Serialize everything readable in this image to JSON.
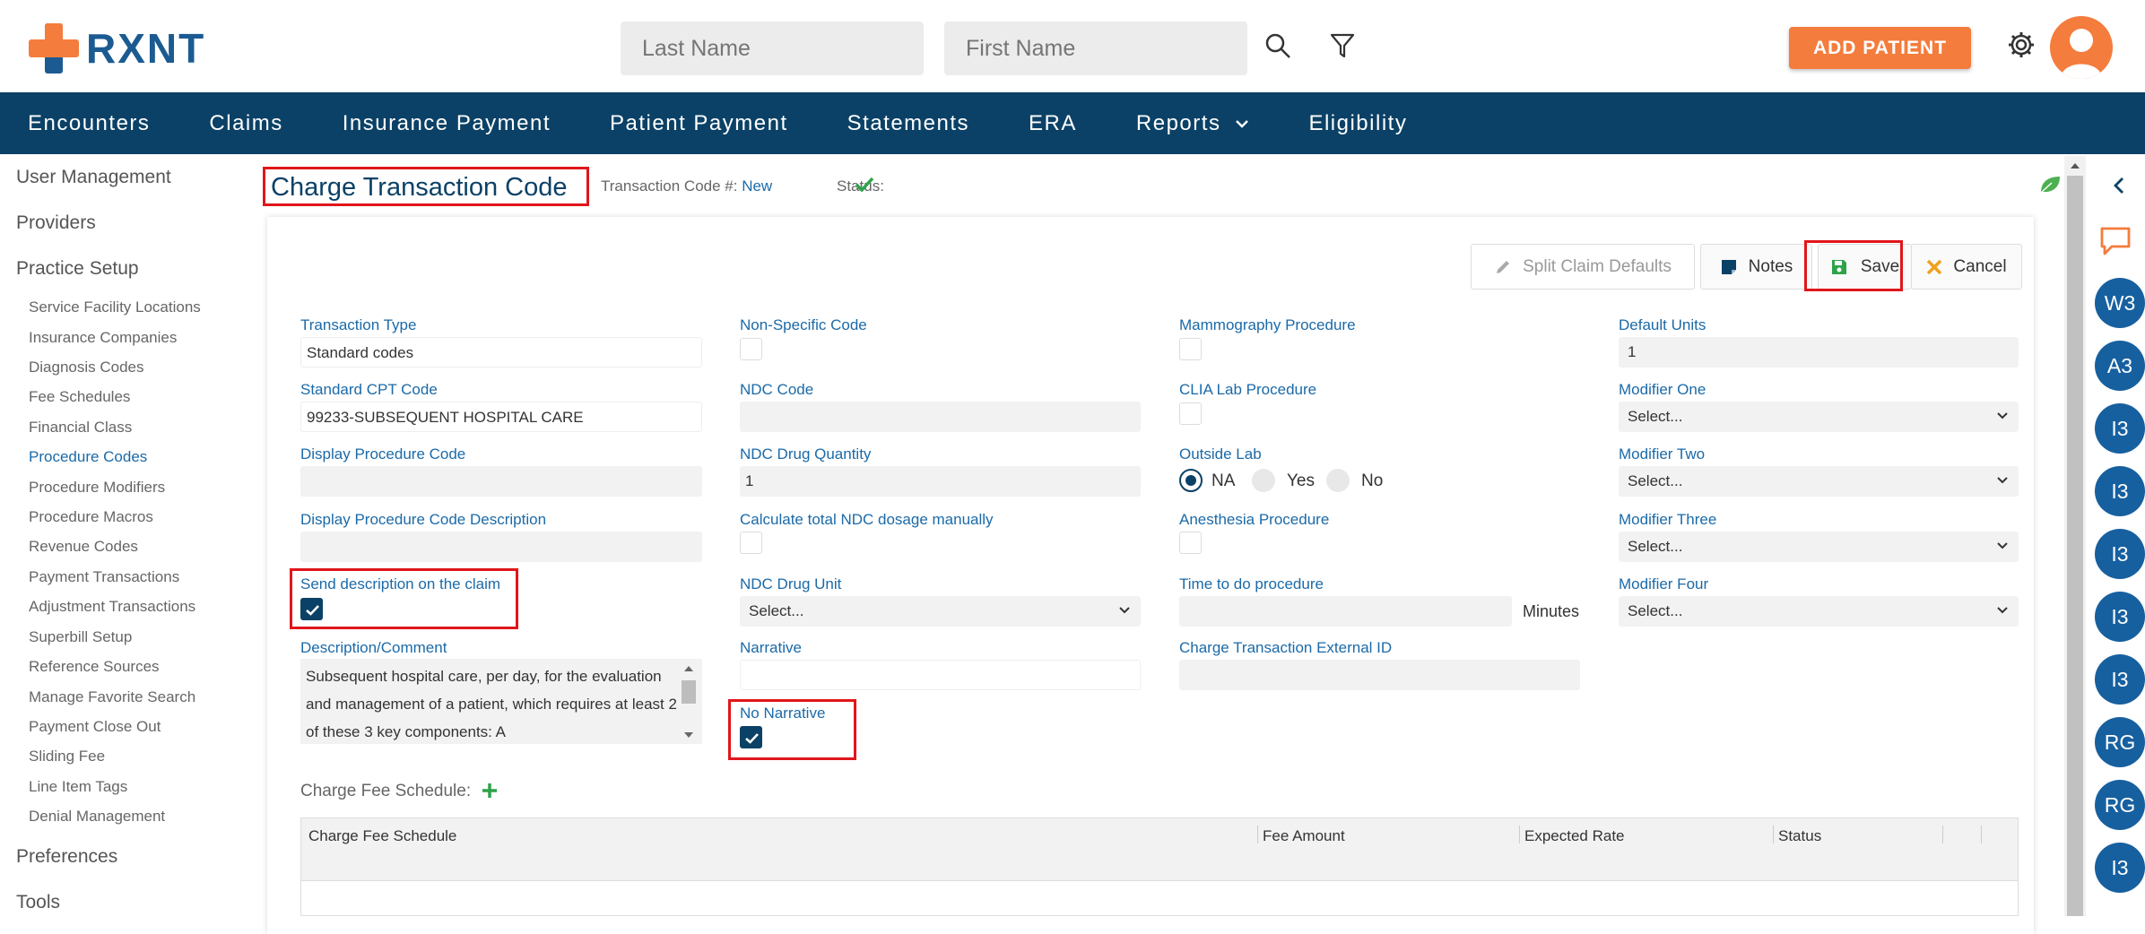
{
  "app": {
    "brand": "RXNT"
  },
  "header": {
    "last_name_placeholder": "Last Name",
    "first_name_placeholder": "First Name",
    "add_patient_label": "ADD PATIENT"
  },
  "nav": {
    "items": [
      "Encounters",
      "Claims",
      "Insurance Payment",
      "Patient Payment",
      "Statements",
      "ERA",
      "Reports",
      "Eligibility"
    ]
  },
  "sidebar": {
    "sections": [
      "User Management",
      "Providers",
      "Practice Setup",
      "Preferences",
      "Tools"
    ],
    "items": [
      "Service Facility Locations",
      "Insurance Companies",
      "Diagnosis Codes",
      "Fee Schedules",
      "Financial Class",
      "Procedure Codes",
      "Procedure Modifiers",
      "Procedure Macros",
      "Revenue Codes",
      "Payment Transactions",
      "Adjustment Transactions",
      "Superbill Setup",
      "Reference Sources",
      "Manage Favorite Search",
      "Payment Close Out",
      "Sliding Fee",
      "Line Item Tags",
      "Denial Management"
    ],
    "active": "Procedure Codes"
  },
  "page": {
    "title": "Charge Transaction Code",
    "code_label": "Transaction Code #:",
    "code_value": "New",
    "status_label": "Status:"
  },
  "toolbar": {
    "split_label": "Split Claim Defaults",
    "notes_label": "Notes",
    "save_label": "Save",
    "cancel_label": "Cancel"
  },
  "form": {
    "transaction_type": {
      "label": "Transaction Type",
      "value": "Standard codes"
    },
    "standard_cpt": {
      "label": "Standard CPT Code",
      "value": "99233-SUBSEQUENT HOSPITAL CARE"
    },
    "display_code": {
      "label": "Display Procedure Code",
      "value": ""
    },
    "display_desc": {
      "label": "Display Procedure Code Description",
      "value": ""
    },
    "send_desc": {
      "label": "Send description on the claim",
      "checked": true
    },
    "description": {
      "label": "Description/Comment",
      "value": "Subsequent hospital care, per day, for the evaluation and management of a patient, which requires at least 2 of these 3 key components: A"
    },
    "non_specific": {
      "label": "Non-Specific Code",
      "checked": false
    },
    "ndc_code": {
      "label": "NDC Code",
      "value": ""
    },
    "ndc_qty": {
      "label": "NDC Drug Quantity",
      "value": "1"
    },
    "calc_ndc": {
      "label": "Calculate total NDC dosage manually",
      "checked": false
    },
    "ndc_unit": {
      "label": "NDC Drug Unit",
      "value": "Select..."
    },
    "narrative": {
      "label": "Narrative",
      "value": ""
    },
    "no_narrative": {
      "label": "No Narrative",
      "checked": true
    },
    "mammo": {
      "label": "Mammography Procedure",
      "checked": false
    },
    "clia": {
      "label": "CLIA Lab Procedure",
      "checked": false
    },
    "outside_lab": {
      "label": "Outside Lab",
      "options": [
        "NA",
        "Yes",
        "No"
      ],
      "selected": "NA"
    },
    "anesthesia": {
      "label": "Anesthesia Procedure",
      "checked": false
    },
    "time_proc": {
      "label": "Time to do procedure",
      "value": "",
      "unit": "Minutes"
    },
    "external_id": {
      "label": "Charge Transaction External ID",
      "value": ""
    },
    "default_units": {
      "label": "Default Units",
      "value": "1"
    },
    "mod1": {
      "label": "Modifier One",
      "value": "Select..."
    },
    "mod2": {
      "label": "Modifier Two",
      "value": "Select..."
    },
    "mod3": {
      "label": "Modifier Three",
      "value": "Select..."
    },
    "mod4": {
      "label": "Modifier Four",
      "value": "Select..."
    }
  },
  "fee_schedule": {
    "label": "Charge Fee Schedule:",
    "columns": [
      "Charge Fee Schedule",
      "Fee Amount",
      "Expected Rate",
      "Status"
    ]
  },
  "right_rail": {
    "badges": [
      "W3",
      "A3",
      "I3",
      "I3",
      "I3",
      "I3",
      "I3",
      "RG",
      "RG",
      "I3"
    ]
  },
  "colors": {
    "primary": "#0b4166",
    "accent": "#f47c3c",
    "link": "#1b6aa8",
    "highlight": "#e0161b",
    "badge": "#1660a0"
  }
}
